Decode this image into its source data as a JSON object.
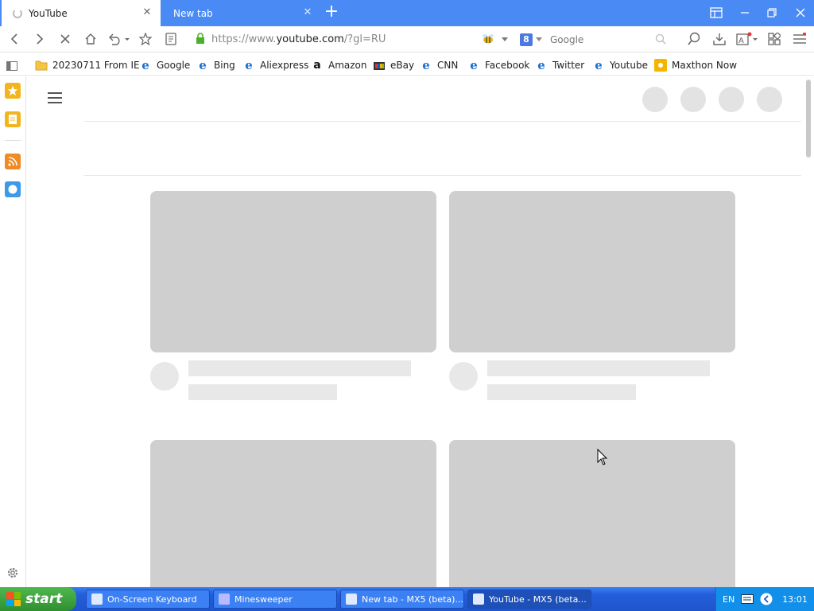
{
  "tabs": [
    {
      "title": "YouTube",
      "active": true
    },
    {
      "title": "New tab",
      "active": false
    }
  ],
  "address": {
    "prefix": "https://www.",
    "host": "youtube.com",
    "path": "/?gl=RU"
  },
  "search": {
    "engine": "8",
    "placeholder": "Google"
  },
  "bookmarks": [
    {
      "label": "20230711 From IE",
      "icon": "folder-icon"
    },
    {
      "label": "Google",
      "icon": "ie-icon"
    },
    {
      "label": "Bing",
      "icon": "ie-icon"
    },
    {
      "label": "Aliexpress",
      "icon": "ie-icon"
    },
    {
      "label": "Amazon",
      "icon": "amazon-icon"
    },
    {
      "label": "eBay",
      "icon": "ebay-icon"
    },
    {
      "label": "CNN",
      "icon": "ie-icon"
    },
    {
      "label": "Facebook",
      "icon": "ie-icon"
    },
    {
      "label": "Twitter",
      "icon": "ie-icon"
    },
    {
      "label": "Youtube",
      "icon": "ie-icon"
    },
    {
      "label": "Maxthon Now",
      "icon": "maxthon-now-icon"
    }
  ],
  "taskbar": {
    "start_label": "start",
    "tasks": [
      {
        "label": "On-Screen Keyboard"
      },
      {
        "label": "Minesweeper"
      },
      {
        "label": "New tab - MX5 (beta)..."
      },
      {
        "label": "YouTube - MX5 (beta..."
      }
    ],
    "lang": "EN",
    "clock": "13:01"
  },
  "colors": {
    "tabbar": "#4a8af4",
    "skeleton": "#cfcfcf",
    "taskbar": "#245edb",
    "start": "#2f8f2f"
  }
}
